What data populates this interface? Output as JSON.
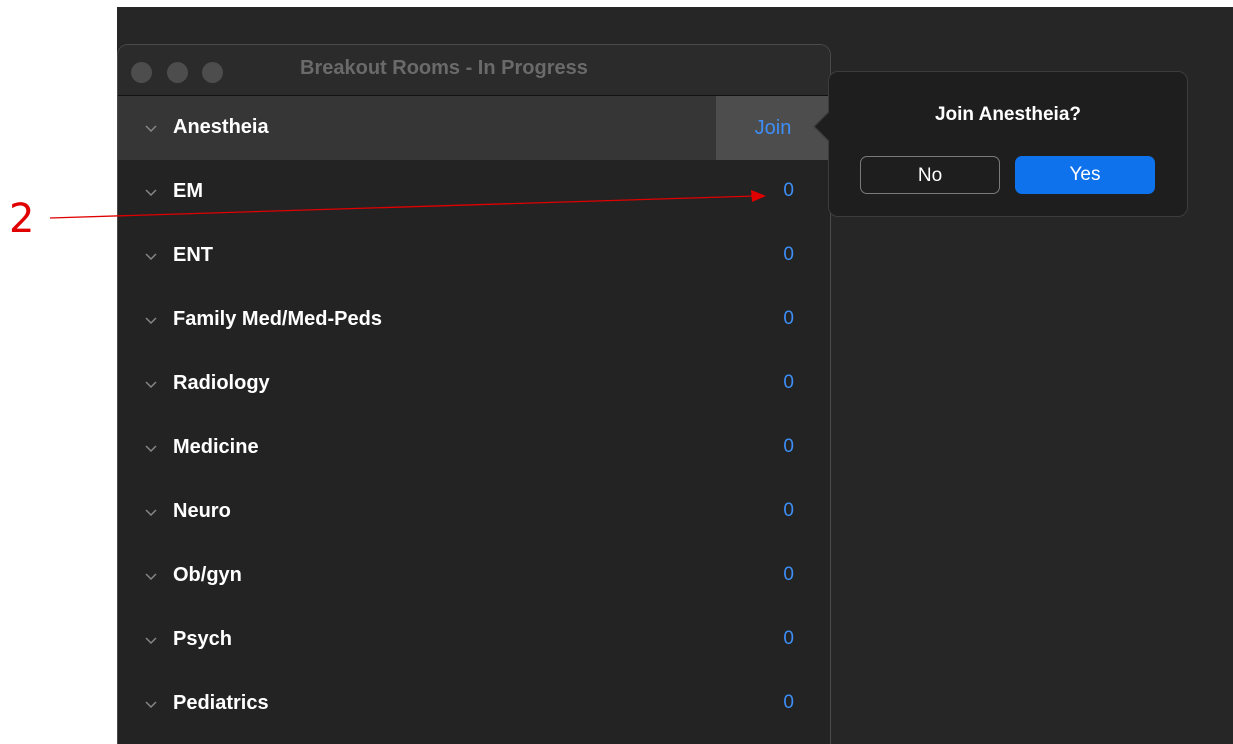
{
  "window": {
    "title": "Breakout Rooms - In Progress"
  },
  "rooms": [
    {
      "name": "Anestheia",
      "action": "Join",
      "selected": true
    },
    {
      "name": "EM",
      "count": "0"
    },
    {
      "name": "ENT",
      "count": "0"
    },
    {
      "name": "Family Med/Med-Peds",
      "count": "0"
    },
    {
      "name": "Radiology",
      "count": "0"
    },
    {
      "name": "Medicine",
      "count": "0"
    },
    {
      "name": "Neuro",
      "count": "0"
    },
    {
      "name": "Ob/gyn",
      "count": "0"
    },
    {
      "name": "Psych",
      "count": "0"
    },
    {
      "name": "Pediatrics",
      "count": "0"
    }
  ],
  "popover": {
    "title": "Join Anestheia?",
    "no_label": "No",
    "yes_label": "Yes"
  },
  "annotation": {
    "label": "2"
  },
  "colors": {
    "accent": "#3e8ef7",
    "primary_button": "#0e72ed",
    "annotation": "#e00000"
  },
  "icons": {
    "row_expand": "chevron-down-icon"
  }
}
